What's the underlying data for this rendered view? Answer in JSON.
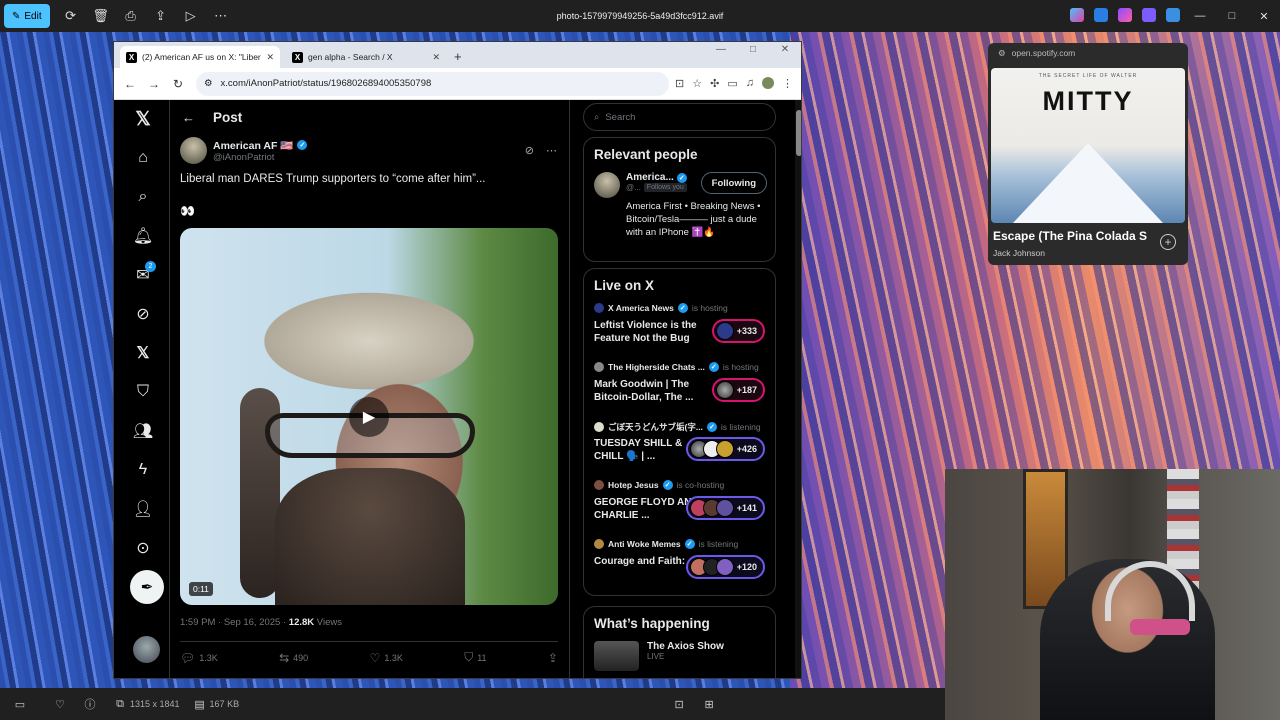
{
  "viewer": {
    "edit_label": "Edit",
    "file_title": "photo-1579979949256-5a49d3fcc912.avif",
    "dimensions": "1315 x 1841",
    "file_size": "167 KB"
  },
  "browser": {
    "tabs": [
      {
        "label": "(2) American AF us on X: \"Liber",
        "active": true
      },
      {
        "label": "gen alpha - Search / X",
        "active": false
      }
    ],
    "url": "x.com/iAnonPatriot/status/1968026894005350798"
  },
  "x": {
    "nav_badge": "2",
    "post_header": "Post",
    "author": {
      "name": "American AF 🇺🇸",
      "handle": "@iAnonPatriot"
    },
    "text": "Liberal man DARES Trump supporters to “come after him”...",
    "emoji": "👀",
    "video_time": "0:11",
    "timestamp": "1:59 PM · Sep 16, 2025 ·",
    "views_count": "12.8K",
    "views_label": "Views",
    "engagement": {
      "replies": "1.3K",
      "reposts": "490",
      "likes": "1.3K",
      "bookmarks": "11"
    },
    "search_placeholder": "Search",
    "relevant_people": {
      "heading": "Relevant people",
      "name": "America...",
      "handle": "@...",
      "follows_you": "Follows you",
      "button": "Following",
      "bio": "America First • Breaking News • Bitcoin/Tesla——— just a dude with an IPhone ✝️🔥"
    },
    "live": {
      "heading": "Live on X",
      "items": [
        {
          "host": "X America News",
          "status": "is hosting",
          "title": "Leftist Violence is the Feature Not the Bug",
          "count": "+333",
          "color": "pink"
        },
        {
          "host": "The Higherside Chats ...",
          "status": "is hosting",
          "title": "Mark Goodwin | The Bitcoin-Dollar, The ...",
          "count": "+187",
          "color": "pink"
        },
        {
          "host": "ごぼ天うどんサブ垢(字...",
          "status": "is listening",
          "title": "TUESDAY SHILL & CHILL 🗣️ | ...",
          "count": "+426",
          "color": "blue"
        },
        {
          "host": "Hotep Jesus",
          "status": "is co-hosting",
          "title": "GEORGE FLOYD AND CHARLIE ...",
          "count": "+141",
          "color": "blue"
        },
        {
          "host": "Anti Woke Memes",
          "status": "is listening",
          "title": "Courage and Faith: ...",
          "count": "+120",
          "color": "blue"
        }
      ]
    },
    "happening": {
      "heading": "What’s happening",
      "item_title": "The Axios Show",
      "item_sub": "LIVE"
    }
  },
  "spotify": {
    "domain": "open.spotify.com",
    "art_sub": "THE SECRET LIFE OF WALTER",
    "art_title": "MITTY",
    "track": "Escape (The Pina Colada S",
    "artist": "Jack Johnson"
  }
}
